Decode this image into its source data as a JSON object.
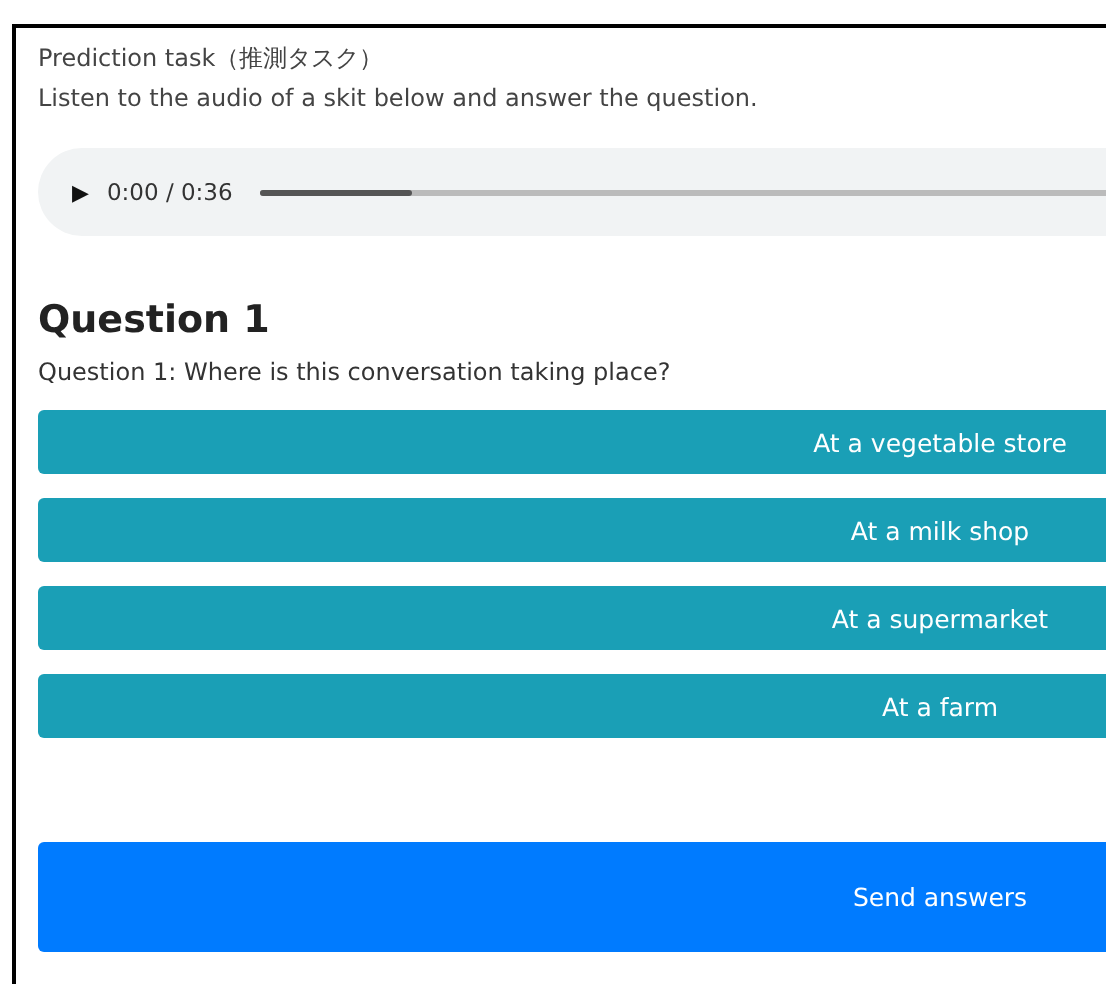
{
  "task": {
    "title": "Prediction task（推測タスク）",
    "instruction": "Listen to the audio of a skit below and answer the question."
  },
  "audio": {
    "play_icon": "▶",
    "time": "0:00 / 0:36",
    "level": 0.1
  },
  "question": {
    "heading": "Question 1",
    "text": "Question 1: Where is this conversation taking place?",
    "options": [
      {
        "label": "At a vegetable store"
      },
      {
        "label": "At a milk shop"
      },
      {
        "label": "At a supermarket"
      },
      {
        "label": "At a farm"
      }
    ]
  },
  "submit": {
    "label": "Send answers"
  }
}
